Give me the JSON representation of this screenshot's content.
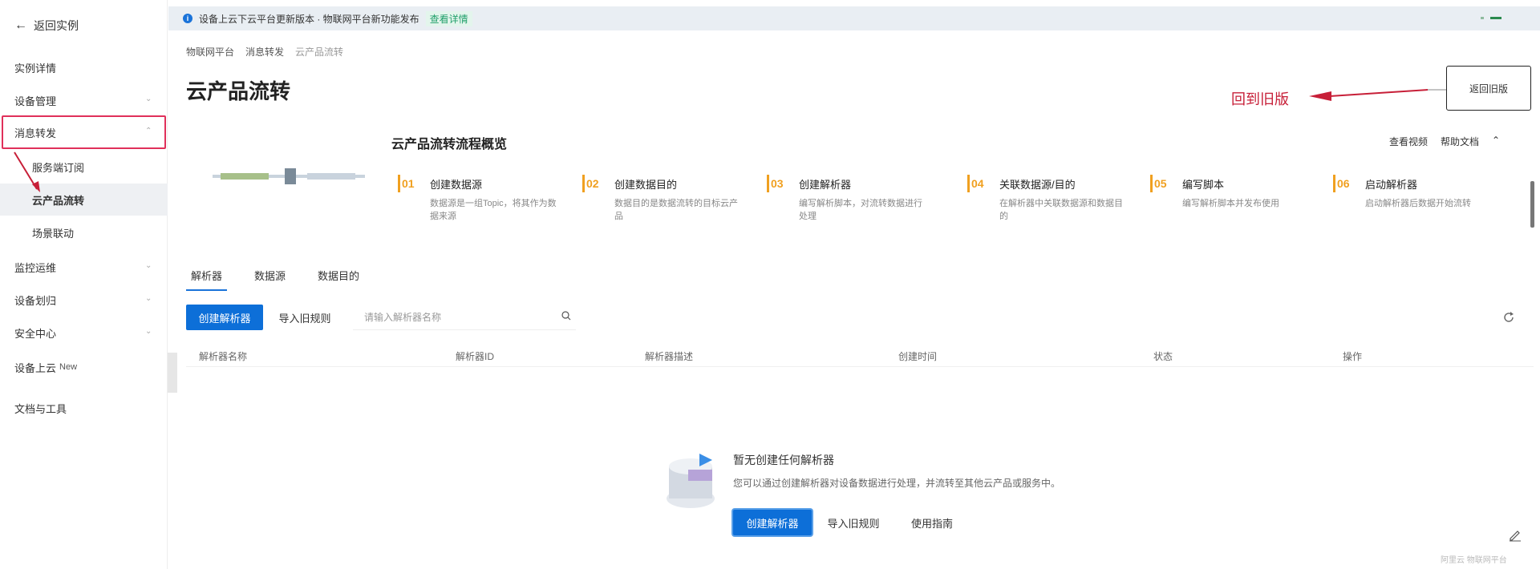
{
  "notice": {
    "text": "设备上云下云平台更新版本 · 物联网平台新功能发布",
    "link": "查看详情"
  },
  "sidebar": {
    "back_label": "返回实例",
    "items": [
      {
        "label": "实例详情"
      },
      {
        "label": "设备管理"
      },
      {
        "label": "消息转发"
      },
      {
        "label": "服务端订阅"
      },
      {
        "label": "云产品流转"
      },
      {
        "label": "场景联动"
      },
      {
        "label": "监控运维"
      },
      {
        "label": "设备划归"
      },
      {
        "label": "安全中心"
      },
      {
        "label": "设备上云",
        "badge": "New"
      },
      {
        "label": "文档与工具"
      }
    ]
  },
  "breadcrumb": [
    "物联网平台",
    "消息转发",
    "云产品流转"
  ],
  "page_title": "云产品流转",
  "switch_old": "返回旧版",
  "annotation": "回到旧版",
  "overview": {
    "title": "云产品流转流程概览",
    "links": [
      "查看视频",
      "帮助文档"
    ],
    "steps": [
      {
        "num": "01",
        "title": "创建数据源",
        "desc": "数据源是一组Topic，将其作为数据来源"
      },
      {
        "num": "02",
        "title": "创建数据目的",
        "desc": "数据目的是数据流转的目标云产品"
      },
      {
        "num": "03",
        "title": "创建解析器",
        "desc": "编写解析脚本，对流转数据进行处理"
      },
      {
        "num": "04",
        "title": "关联数据源/目的",
        "desc": "在解析器中关联数据源和数据目的"
      },
      {
        "num": "05",
        "title": "编写脚本",
        "desc": "编写解析脚本并发布使用"
      },
      {
        "num": "06",
        "title": "启动解析器",
        "desc": "启动解析器后数据开始流转"
      }
    ]
  },
  "tabs": [
    "解析器",
    "数据源",
    "数据目的"
  ],
  "toolbar": {
    "create_label": "创建解析器",
    "import_label": "导入旧规则",
    "search_placeholder": "请输入解析器名称"
  },
  "table": {
    "columns": [
      "解析器名称",
      "解析器ID",
      "解析器描述",
      "创建时间",
      "状态",
      "操作"
    ]
  },
  "empty": {
    "title": "暂无创建任何解析器",
    "desc": "您可以通过创建解析器对设备数据进行处理，并流转至其他云产品或服务中。",
    "create_label": "创建解析器",
    "import_label": "导入旧规则",
    "guide_label": "使用指南"
  },
  "footer": "阿里云 物联网平台",
  "colors": {
    "primary": "#0d6fd8",
    "accent": "#ff6a00",
    "annotation": "#c71f38"
  }
}
